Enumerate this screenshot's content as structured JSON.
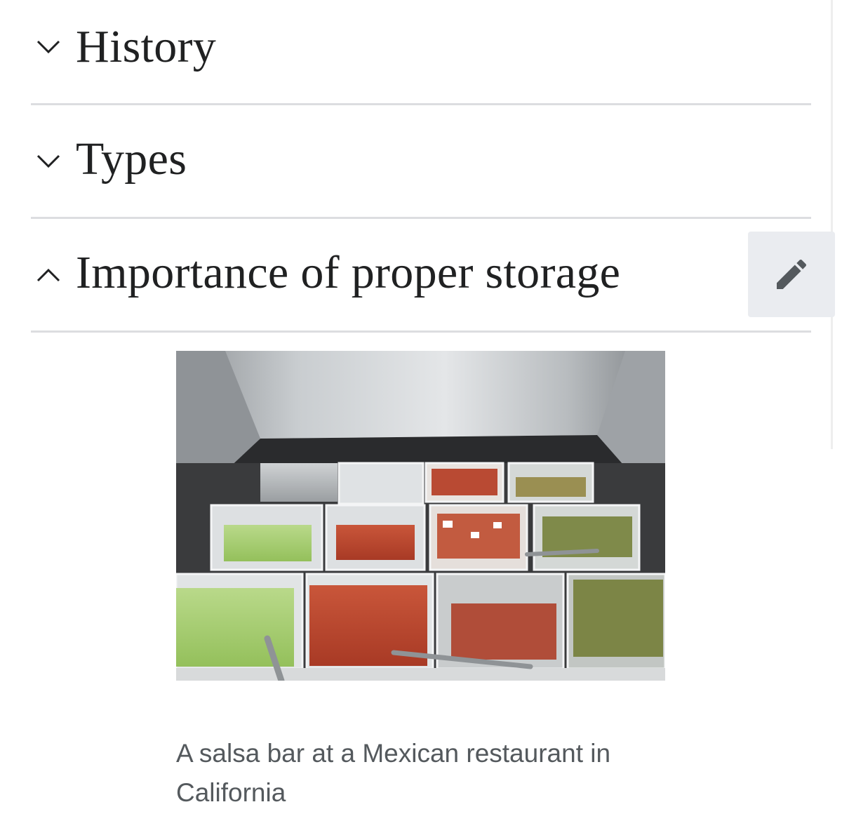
{
  "sections": [
    {
      "title": "History",
      "state": "collapsed",
      "chevron_icon": "chevron-down-icon"
    },
    {
      "title": "Types",
      "state": "collapsed",
      "chevron_icon": "chevron-down-icon"
    },
    {
      "title": "Importance of proper storage",
      "state": "expanded",
      "chevron_icon": "chevron-up-icon"
    }
  ],
  "edit_button": {
    "icon": "pencil-icon"
  },
  "figure": {
    "caption": "A salsa bar at a Mexican restaurant in California"
  },
  "colors": {
    "text": "#202122",
    "caption": "#54595d",
    "divider": "#dcdde0",
    "edit_bg": "#eaecf0",
    "icon": "#54595d"
  }
}
